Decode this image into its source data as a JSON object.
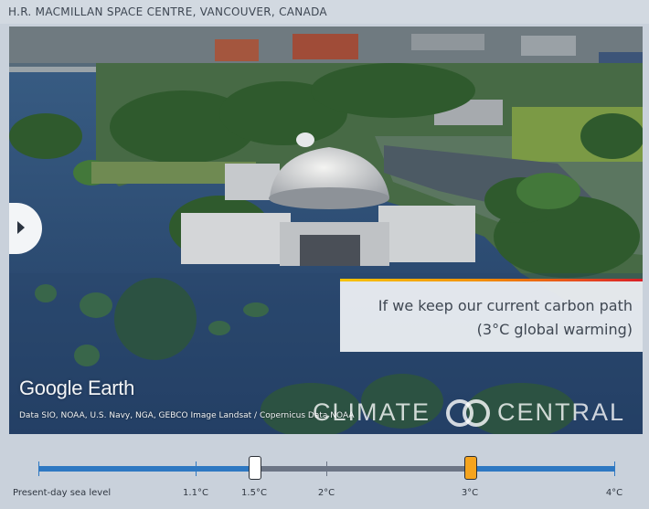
{
  "header": {
    "location": "H.R. MACMILLAN SPACE CENTRE, VANCOUVER, CANADA"
  },
  "viewer": {
    "prev_icon": "chevron-right-icon",
    "info_line1": "If we keep our current carbon path",
    "info_line2": "(3°C global warming)",
    "info_accent": "#f29100",
    "google_logo": "Google Earth",
    "credits": "Data SIO, NOAA, U.S. Navy, NGA, GEBCO Image Landsat / Copernicus Data NOAA",
    "cc_logo_left": "CLIMATE",
    "cc_logo_right": "CENTRAL"
  },
  "slider": {
    "labels": [
      "Present-day sea level",
      "1.1°C",
      "1.5°C",
      "2°C",
      "3°C",
      "4°C"
    ],
    "compare_value": "1.5°C",
    "selected_value": "3°C",
    "track_color": "#2e78c2",
    "selected_color": "#f5a41e"
  }
}
